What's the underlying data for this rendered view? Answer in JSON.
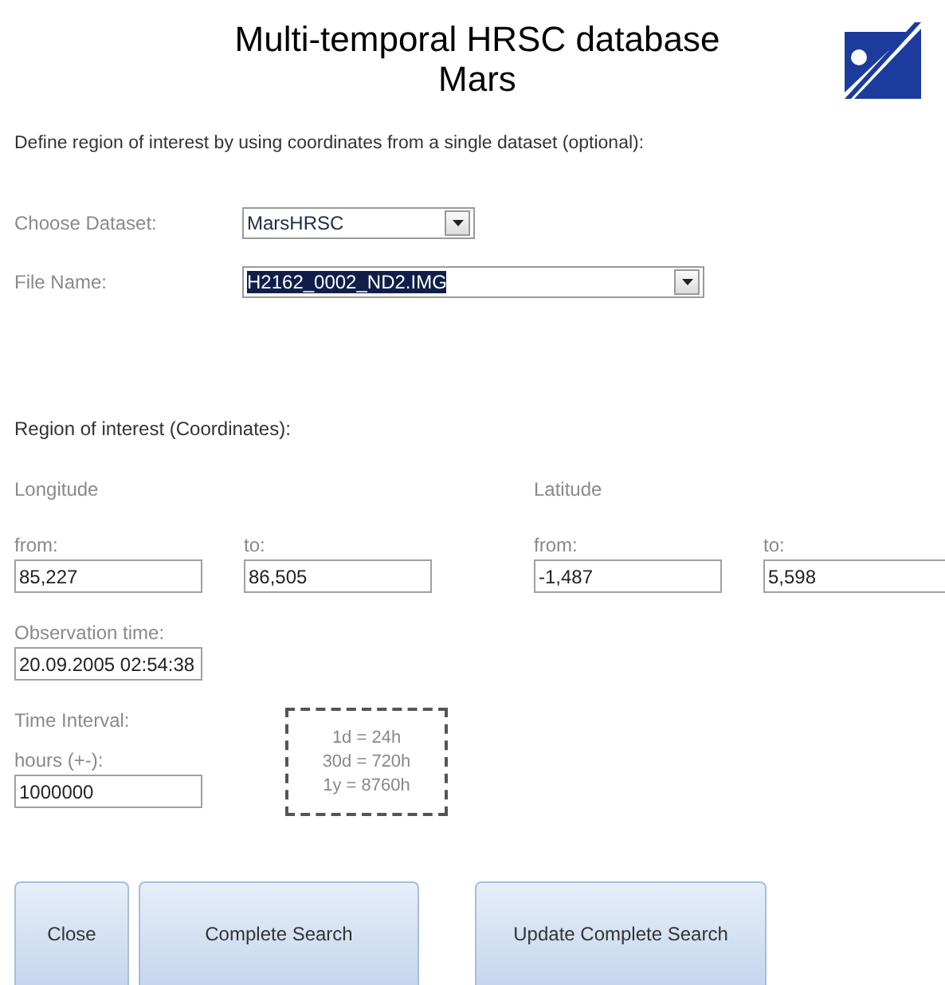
{
  "header": {
    "title_lines": [
      "Multi-temporal HRSC database",
      "Mars"
    ]
  },
  "intro": "Define region of interest by using coordinates from a single dataset (optional):",
  "dataset_fields": [
    {
      "label": "Choose Dataset:",
      "value": "MarsHRSC",
      "text_selected": false
    },
    {
      "label": "File Name:",
      "value": "H2162_0002_ND2.IMG",
      "text_selected": true
    }
  ],
  "region": {
    "heading": "Region of interest (Coordinates):",
    "groups": [
      {
        "title": "Longitude",
        "fields": [
          {
            "label": "from:",
            "value": "85,227"
          },
          {
            "label": "to:",
            "value": "86,505"
          }
        ]
      },
      {
        "title": "Latitude",
        "fields": [
          {
            "label": "from:",
            "value": "-1,487"
          },
          {
            "label": "to:",
            "value": "5,598"
          }
        ]
      }
    ]
  },
  "observation": {
    "label": "Observation time:",
    "value": "20.09.2005 02:54:38"
  },
  "interval": {
    "heading": "Time Interval:",
    "label": "hours (+-):",
    "value": "1000000",
    "notes": [
      "1d = 24h",
      "30d = 720h",
      "1y = 8760h"
    ]
  },
  "buttons": [
    "Close",
    "Complete Search",
    "Update Complete Search"
  ]
}
